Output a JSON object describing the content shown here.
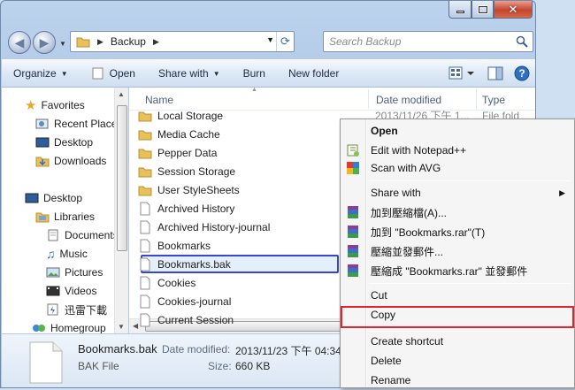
{
  "window": {
    "controls": [
      "minimize",
      "maximize",
      "close"
    ]
  },
  "address": {
    "crumb": "Backup",
    "search_placeholder": "Search Backup"
  },
  "toolbar": {
    "organize": "Organize",
    "open": "Open",
    "share_with": "Share with",
    "burn": "Burn",
    "new_folder": "New folder"
  },
  "navpane": {
    "items": [
      {
        "label": "Favorites",
        "icon": "star-icon"
      },
      {
        "label": "Recent Places",
        "icon": "recent-places-icon"
      },
      {
        "label": "Desktop",
        "icon": "desktop-icon"
      },
      {
        "label": "Downloads",
        "icon": "downloads-icon"
      },
      {
        "label": "Desktop",
        "icon": "desktop-icon"
      },
      {
        "label": "Libraries",
        "icon": "libraries-icon"
      },
      {
        "label": "Documents",
        "icon": "documents-icon"
      },
      {
        "label": "Music",
        "icon": "music-icon"
      },
      {
        "label": "Pictures",
        "icon": "pictures-icon"
      },
      {
        "label": "Videos",
        "icon": "videos-icon"
      },
      {
        "label": "迅雷下載",
        "icon": "thunder-download-icon"
      },
      {
        "label": "Homegroup",
        "icon": "homegroup-icon"
      }
    ]
  },
  "files": {
    "columns": {
      "name": "Name",
      "date": "Date modified",
      "type": "Type"
    },
    "rows": [
      {
        "name": "Local Storage",
        "kind": "folder",
        "date": "2013/11/26 下午 1...",
        "type": "File fold"
      },
      {
        "name": "Media Cache",
        "kind": "folder",
        "date": "",
        "type": ""
      },
      {
        "name": "Pepper Data",
        "kind": "folder",
        "date": "",
        "type": ""
      },
      {
        "name": "Session Storage",
        "kind": "folder",
        "date": "",
        "type": ""
      },
      {
        "name": "User StyleSheets",
        "kind": "folder",
        "date": "",
        "type": ""
      },
      {
        "name": "Archived History",
        "kind": "file",
        "date": "",
        "type": ""
      },
      {
        "name": "Archived History-journal",
        "kind": "file",
        "date": "",
        "type": ""
      },
      {
        "name": "Bookmarks",
        "kind": "file",
        "date": "",
        "type": ""
      },
      {
        "name": "Bookmarks.bak",
        "kind": "file",
        "date": "",
        "type": ""
      },
      {
        "name": "Cookies",
        "kind": "file",
        "date": "",
        "type": ""
      },
      {
        "name": "Cookies-journal",
        "kind": "file",
        "date": "",
        "type": ""
      },
      {
        "name": "Current Session",
        "kind": "file",
        "date": "",
        "type": ""
      }
    ],
    "selected_index": 8
  },
  "details": {
    "filename": "Bookmarks.bak",
    "filetype": "BAK File",
    "date_label": "Date modified:",
    "date_value": "2013/11/23 下午 04:34",
    "size_label": "Size:",
    "size_value": "660 KB"
  },
  "context_menu": {
    "open": "Open",
    "edit_notepad": "Edit with Notepad++",
    "scan_avg": "Scan with AVG",
    "share_with": "Share with",
    "add_archive": "加到壓縮檔(A)...",
    "add_rar": "加到 \"Bookmarks.rar\"(T)",
    "compress_email": "壓縮並發郵件...",
    "compress_rar_email": "壓縮成 \"Bookmarks.rar\" 並發郵件",
    "cut": "Cut",
    "copy": "Copy",
    "create_shortcut": "Create shortcut",
    "delete": "Delete",
    "rename": "Rename"
  },
  "colors": {
    "selection_border": "#3b46d0",
    "copy_highlight": "#e2242f",
    "folder": "#e8c15a"
  }
}
